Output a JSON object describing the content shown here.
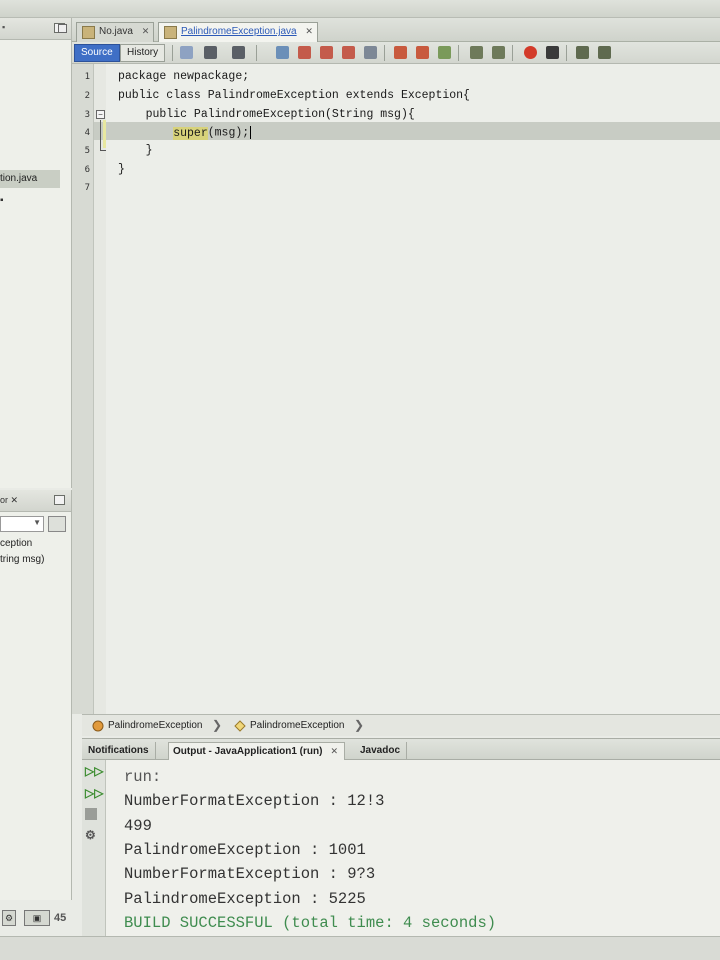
{
  "editor_tabs": [
    {
      "label": "No.java",
      "active": false
    },
    {
      "label": "PalindromeException.java",
      "active": true
    }
  ],
  "toolbar": {
    "source_label": "Source",
    "history_label": "History"
  },
  "left_panel": {
    "selected_file": "tion.java",
    "navigator_title": "or",
    "navigator_items": [
      "ception",
      "tring msg)"
    ]
  },
  "code_lines": [
    {
      "num": "1",
      "text": "package newpackage;"
    },
    {
      "num": "2",
      "text": "public class PalindromeException extends Exception{"
    },
    {
      "num": "3",
      "text": "    public PalindromeException(String msg){"
    },
    {
      "num": "4",
      "prefix": "        ",
      "highlight": "super",
      "suffix": "(msg);"
    },
    {
      "num": "5",
      "text": "    }"
    },
    {
      "num": "6",
      "text": "}"
    },
    {
      "num": "7",
      "text": ""
    }
  ],
  "breadcrumb": [
    "PalindromeException",
    "PalindromeException"
  ],
  "output_tabs": [
    {
      "label": "Notifications",
      "active": false
    },
    {
      "label": "Output - JavaApplication1 (run)",
      "active": true
    },
    {
      "label": "Javadoc",
      "active": false
    }
  ],
  "output_lines": [
    "run:",
    "NumberFormatException : 12!3",
    "499",
    "PalindromeException : 1001",
    "NumberFormatException : 9?3",
    "PalindromeException : 5225",
    "BUILD SUCCESSFUL (total time: 4 seconds)"
  ],
  "status": {
    "line_count": "45"
  },
  "colors": {
    "source_tab": "#3f6fc6",
    "editor_bg": "#eceee9",
    "current_line": "#c8ccc4",
    "highlight": "#d7d27a",
    "success_text": "#3f8c4f"
  }
}
